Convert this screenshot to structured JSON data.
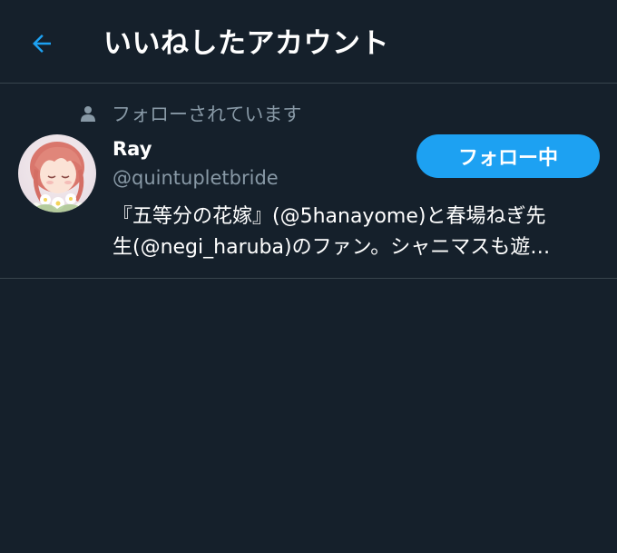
{
  "header": {
    "title": "いいねしたアカウント",
    "back_icon": "arrow-left-icon",
    "accent_color": "#1da1f2"
  },
  "user": {
    "follows_you_label": "フォローされています",
    "display_name": "Ray",
    "screen_name": "@quintupletbride",
    "follow_button_label": "フォロー中",
    "bio_line1": "『五等分の花嫁』(@5hanayome)と春場ねぎ先",
    "bio_line2": "生(@negi_haruba)のファン。シャニマスも遊…"
  }
}
